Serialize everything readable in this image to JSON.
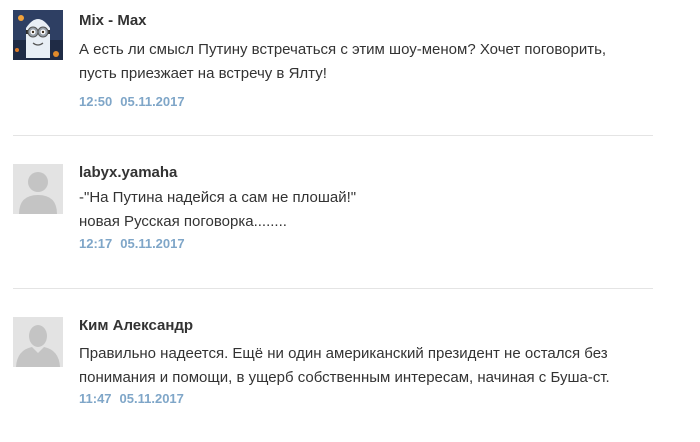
{
  "comments": [
    {
      "author": "Mix - Max",
      "avatar": "minion-avatar",
      "lines": [
        "А есть ли смысл Путину встречаться с этим шоу-меном? Хочет поговорить,",
        "пусть приезжает на встречу в Ялту!"
      ],
      "time": "12:50",
      "date": "05.11.2017"
    },
    {
      "author": "labyx.yamaha",
      "avatar": "default-user-avatar",
      "lines": [
        "-\"На Путина надейся а сам не плошай!\"",
        "новая Русская поговорка........"
      ],
      "time": "12:17",
      "date": "05.11.2017"
    },
    {
      "author": "Ким Александр",
      "avatar": "default-user-avatar",
      "lines": [
        "Правильно надеется. Ещё ни один американский президент не остался без",
        "понимания и помощи, в ущерб собственным интересам, начиная с Буша-ст."
      ],
      "time": "11:47",
      "date": "05.11.2017"
    }
  ],
  "colors": {
    "author": "#333333",
    "text": "#333333",
    "meta": "#7fa6c8",
    "divider": "#e4e4e4",
    "avatar_bg": "#e3e3e3",
    "avatar_silhouette": "#c4c4c4"
  }
}
